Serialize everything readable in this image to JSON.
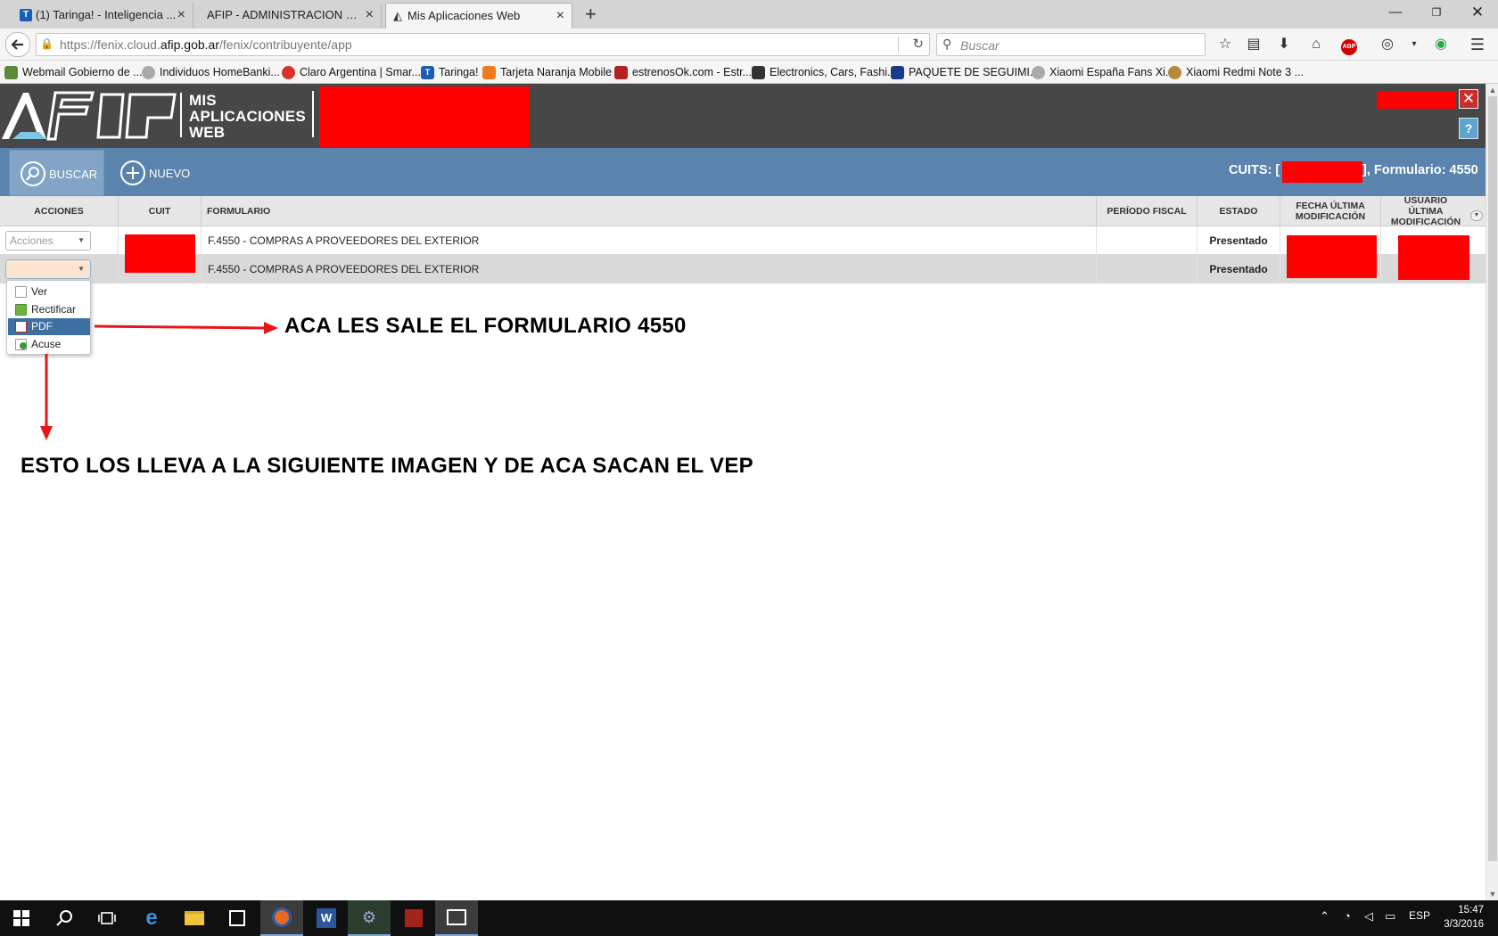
{
  "browser": {
    "tabs": [
      {
        "label": "(1) Taringa! - Inteligencia ...",
        "favicon": "taringa-icon",
        "active": false
      },
      {
        "label": "AFIP - ADMINISTRACION FED...",
        "favicon": "blank",
        "active": false
      },
      {
        "label": "Mis Aplicaciones Web",
        "favicon": "afip-icon",
        "active": true
      }
    ],
    "url": {
      "prefix": "https://fenix.cloud.",
      "domain": "afip.gob.ar",
      "path": "/fenix/contribuyente/app"
    },
    "search_placeholder": "Buscar",
    "bookmarks": [
      {
        "label": "Webmail Gobierno de ...",
        "color": "#5a8a3a"
      },
      {
        "label": "Individuos HomeBanki...",
        "color": "#999999"
      },
      {
        "label": "Claro Argentina | Smar...",
        "color": "#d9322b"
      },
      {
        "label": "Taringa!",
        "color": "#1a5fb4"
      },
      {
        "label": "Tarjeta Naranja Mobile",
        "color": "#f07a20"
      },
      {
        "label": "estrenosOk.com - Estr...",
        "color": "#b22222"
      },
      {
        "label": "Electronics, Cars, Fashi...",
        "color": "#333333"
      },
      {
        "label": "PAQUETE DE SEGUIMI...",
        "color": "#1a3a8a"
      },
      {
        "label": "Xiaomi España Fans Xi...",
        "color": "#999999"
      },
      {
        "label": "Xiaomi Redmi Note 3 ...",
        "color": "#b58b3a"
      }
    ]
  },
  "app": {
    "title_lines": [
      "MIS",
      "APLICACIONES",
      "WEB"
    ],
    "toolbar": {
      "buscar": "BUSCAR",
      "nuevo": "NUEVO",
      "cuits_label": "CUITS: [",
      "form_label": "], Formulario: 4550"
    },
    "columns": [
      "ACCIONES",
      "CUIT",
      "FORMULARIO",
      "PERÍODO FISCAL",
      "ESTADO",
      "FECHA ÚLTIMA MODIFICACIÓN",
      "USUARIO ÚLTIMA MODIFICACIÓN"
    ],
    "rows": [
      {
        "accion": "Acciones",
        "formulario": "F.4550 - COMPRAS A PROVEEDORES DEL EXTERIOR",
        "periodo": "",
        "estado": "Presentado"
      },
      {
        "accion": "",
        "formulario": "F.4550 - COMPRAS A PROVEEDORES DEL EXTERIOR",
        "periodo": "",
        "estado": "Presentado"
      }
    ],
    "action_menu": [
      {
        "label": "Ver",
        "icon": "view-icon",
        "selected": false
      },
      {
        "label": "Rectificar",
        "icon": "edit-icon",
        "selected": false
      },
      {
        "label": "PDF",
        "icon": "pdf-icon",
        "selected": true
      },
      {
        "label": "Acuse",
        "icon": "download-icon",
        "selected": false
      }
    ]
  },
  "annotations": {
    "right_arrow_text": "ACA LES SALE EL FORMULARIO 4550",
    "down_arrow_text": "ESTO LOS LLEVA A LA SIGUIENTE IMAGEN Y DE ACA SACAN EL VEP",
    "arrow_color": "#e8141b"
  },
  "taskbar": {
    "time": "15:47",
    "date": "3/3/2016",
    "lang": "ESP"
  },
  "colors": {
    "header_bg": "#474747",
    "toolbar_bg": "#5a84ad",
    "redaction": "#ff0000",
    "menu_selected": "#3d6fa1"
  }
}
